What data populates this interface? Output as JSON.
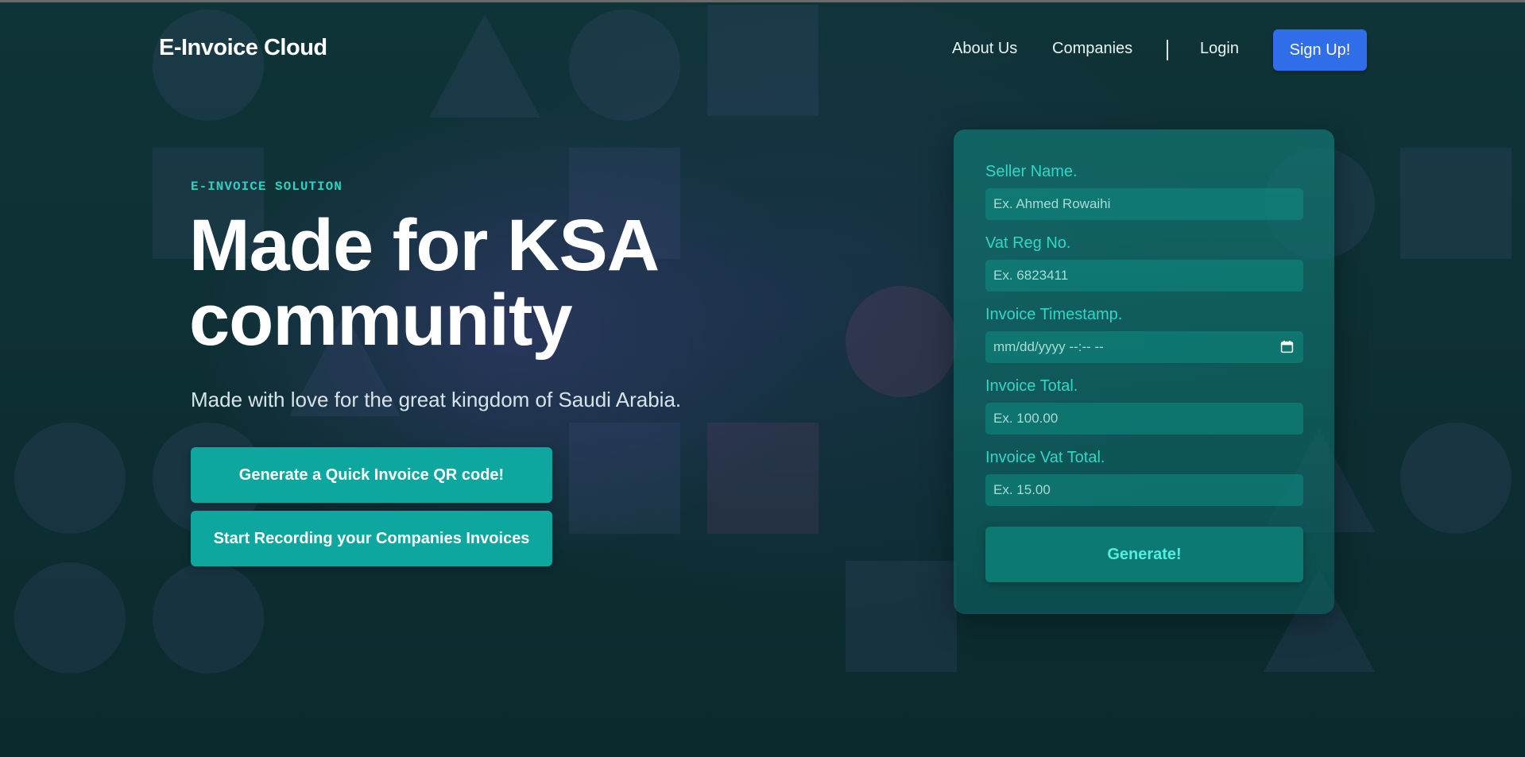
{
  "nav": {
    "brand": "E-Invoice Cloud",
    "links": [
      "About Us",
      "Companies",
      "Login"
    ],
    "signup_label": "Sign Up!"
  },
  "hero": {
    "eyebrow": "E-INVOICE SOLUTION",
    "headline_line1": "Made for KSA",
    "headline_line2": "community",
    "subhead": "Made with love for the great kingdom of Saudi Arabia.",
    "primary_button": "Generate a Quick Invoice QR code!",
    "secondary_button": "Start Recording your Companies Invoices"
  },
  "form": {
    "fields": [
      {
        "label": "Seller Name.",
        "placeholder": "Ex. Ahmed Rowaihi"
      },
      {
        "label": "Vat Reg No.",
        "placeholder": "Ex. 6823411"
      },
      {
        "label": "Invoice Timestamp.",
        "placeholder": "mm/dd/yyyy --:-- --"
      },
      {
        "label": "Invoice Total.",
        "placeholder": "Ex. 100.00"
      },
      {
        "label": "Invoice Vat Total.",
        "placeholder": "Ex. 15.00"
      }
    ],
    "submit_label": "Generate!",
    "icons": {
      "timestamp": "calendar-icon"
    }
  },
  "colors": {
    "background": "#0d2f33",
    "accent_teal": "#0ea79f",
    "signup_blue": "#2f6ee8",
    "label_teal": "#33d6c6"
  }
}
